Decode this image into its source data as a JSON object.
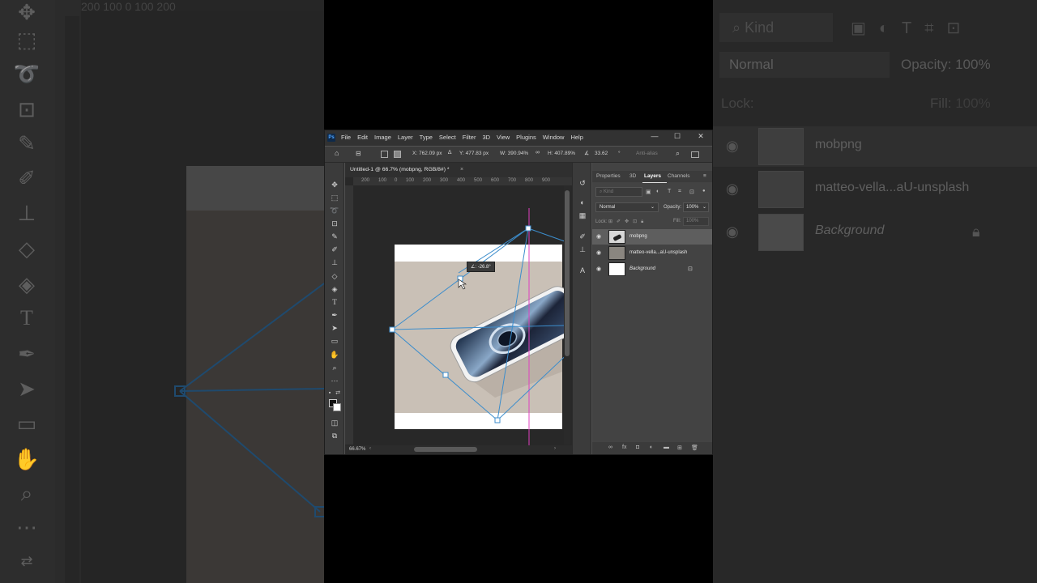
{
  "app": {
    "menu": [
      "File",
      "Edit",
      "Image",
      "Layer",
      "Type",
      "Select",
      "Filter",
      "3D",
      "View",
      "Plugins",
      "Window",
      "Help"
    ],
    "window_controls": [
      "—",
      "☐",
      "✕"
    ],
    "logo": "Ps"
  },
  "options_bar": {
    "x_label": "X:",
    "x_value": "762.09 px",
    "y_label": "Y:",
    "y_value": "477.83 px",
    "w_label": "W:",
    "w_value": "390.94%",
    "h_label": "H:",
    "h_value": "407.89%",
    "angle_value": "33.62",
    "angle_unit": "°",
    "antialias": "Anti-alias"
  },
  "document": {
    "tab_title": "Untitled-1 @ 66.7% (mobpng, RGB/8#) *",
    "tab_close": "×",
    "zoom": "66.67%",
    "ruler_ticks": [
      "200",
      "100",
      "0",
      "100",
      "200",
      "300",
      "400",
      "500",
      "600",
      "700",
      "800",
      "900"
    ],
    "rotate_tooltip": "∠: -26.8°"
  },
  "layers_panel": {
    "tabs": [
      "Properties",
      "3D",
      "Layers",
      "Channels"
    ],
    "active_tab": "Layers",
    "search_placeholder": "Kind",
    "blend_mode": "Normal",
    "opacity_label": "Opacity:",
    "opacity_value": "100%",
    "lock_label": "Lock:",
    "fill_label": "Fill:",
    "fill_value": "100%",
    "layers": [
      {
        "name": "mobpng",
        "selected": true,
        "visible": true
      },
      {
        "name": "matteo-vella...aU-unsplash",
        "selected": false,
        "visible": true
      },
      {
        "name": "Background",
        "selected": false,
        "visible": true,
        "locked": true
      }
    ]
  },
  "backdrop": {
    "search_text": "Kind",
    "blend_mode": "Normal",
    "opacity_label": "Opacity:",
    "opacity_value": "100%",
    "lock_label": "Lock:",
    "fill_label": "Fill:",
    "fill_value": "100%",
    "layers": [
      "mobpng",
      "matteo-vella...aU-unsplash",
      "Background"
    ],
    "ruler_text": "200   100   0   100   200"
  }
}
